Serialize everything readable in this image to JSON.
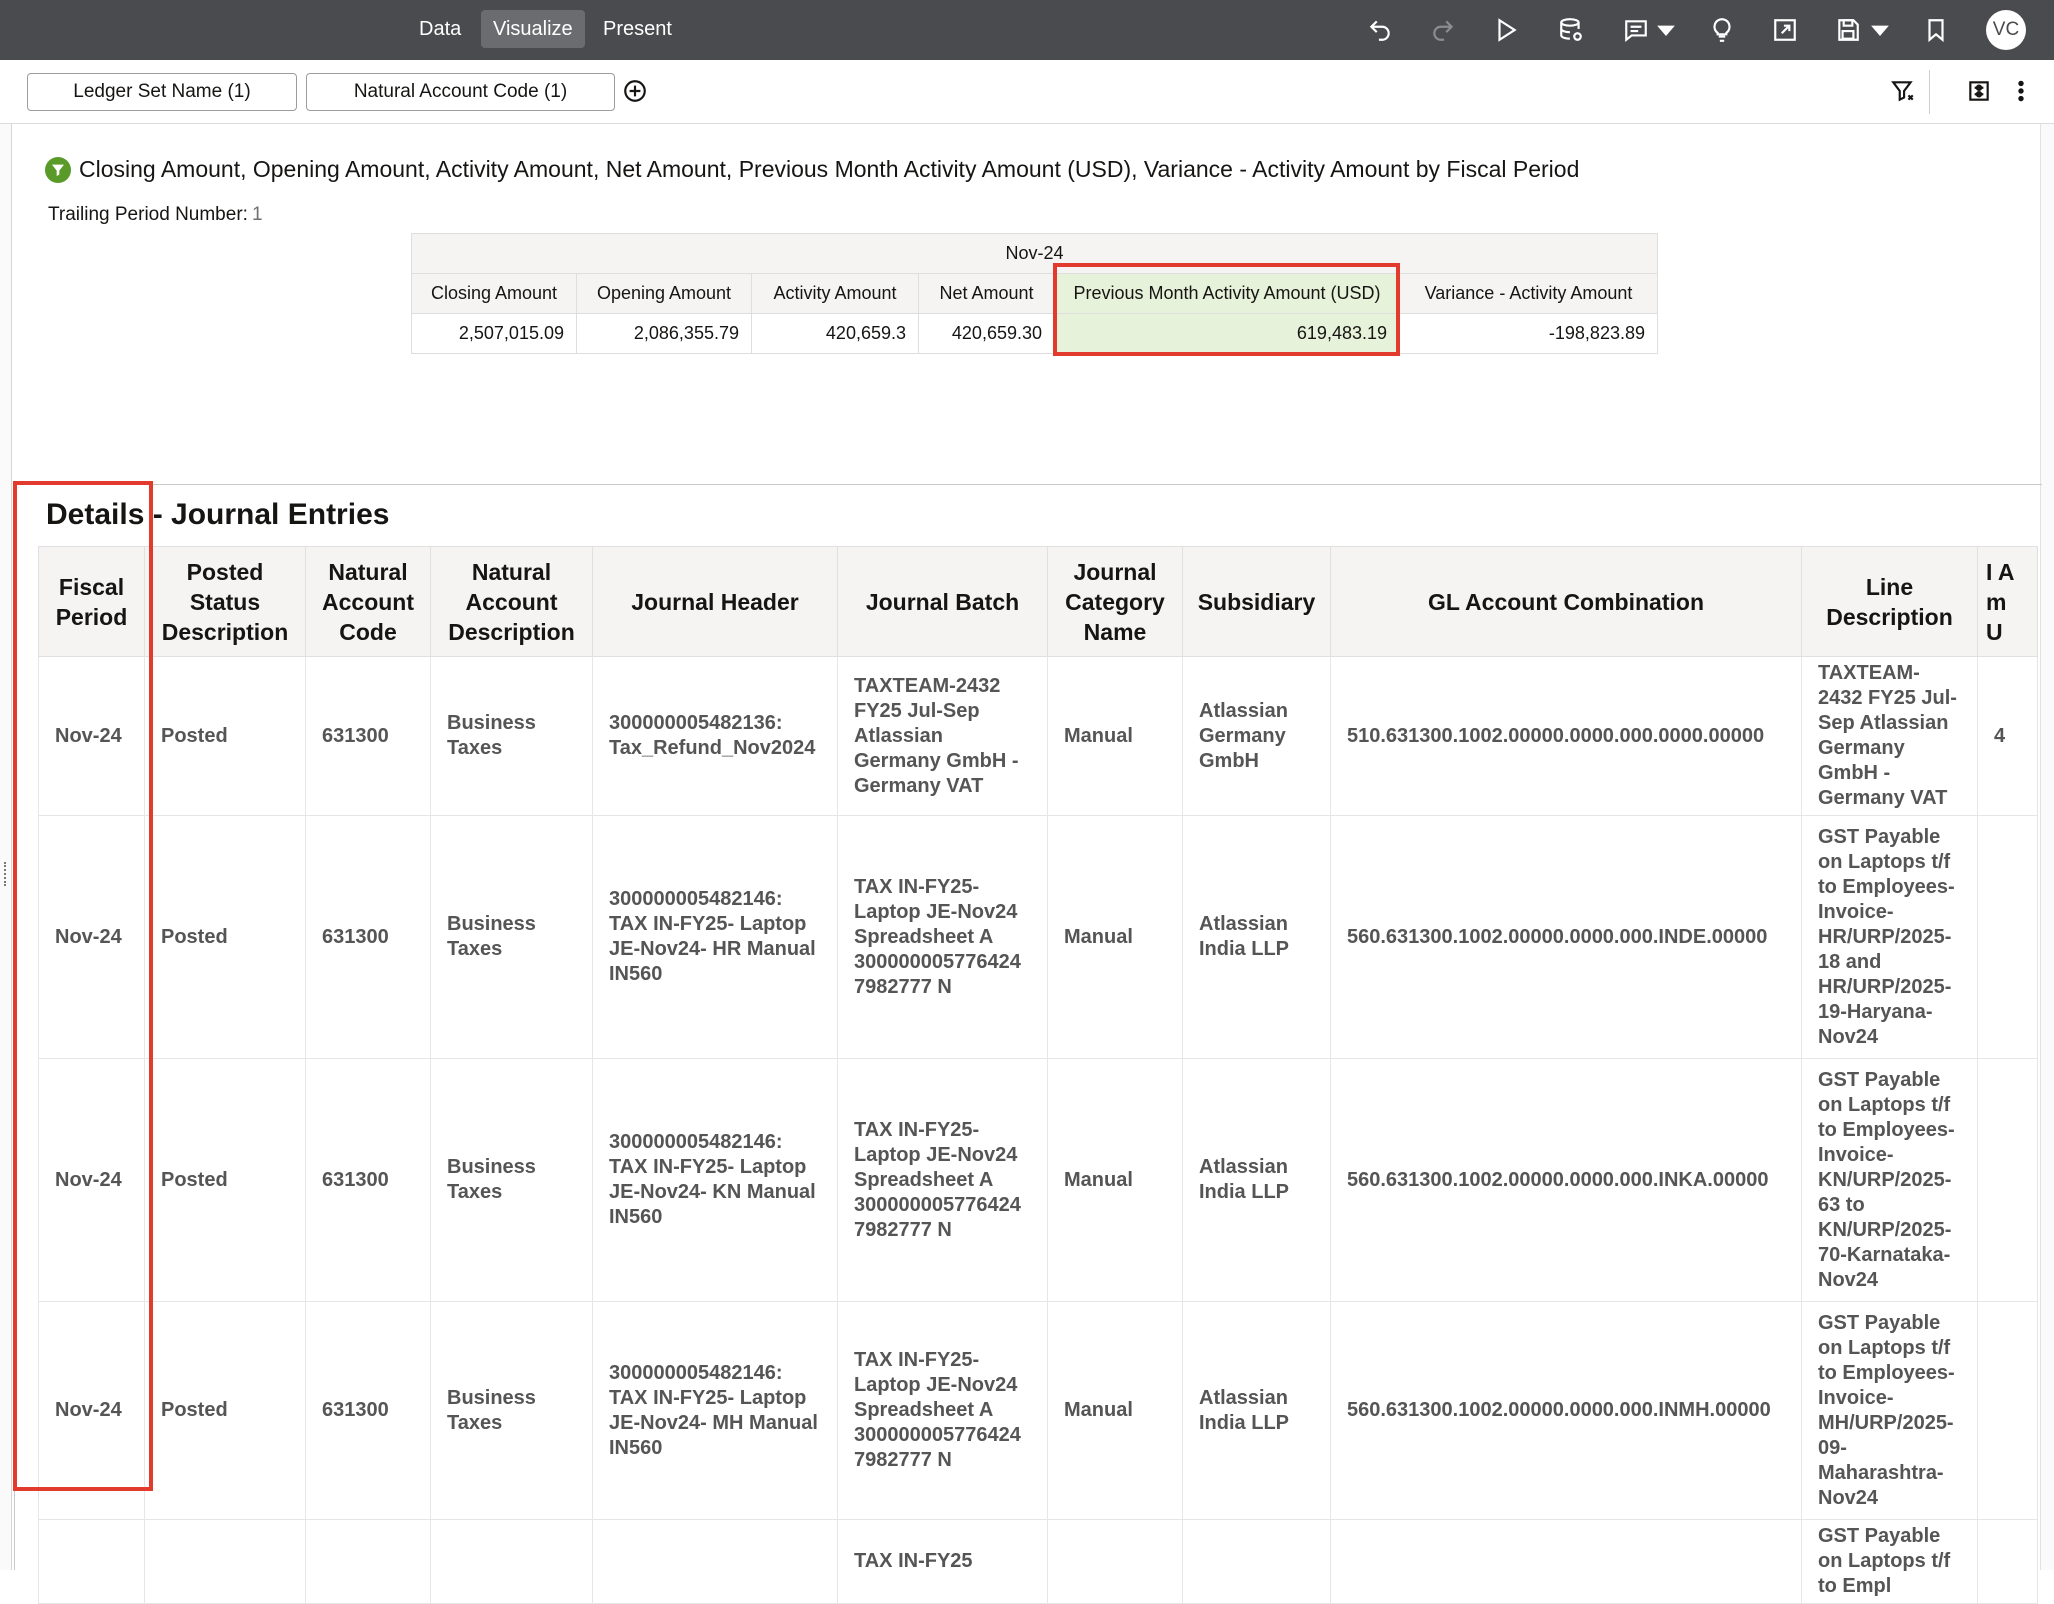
{
  "topbar": {
    "modes": [
      {
        "label": "Data"
      },
      {
        "label": "Visualize"
      },
      {
        "label": "Present"
      }
    ],
    "avatar": "VC"
  },
  "filters": [
    {
      "label": "Ledger Set Name (1)"
    },
    {
      "label": "Natural Account Code (1)"
    }
  ],
  "summary": {
    "title": "Closing Amount, Opening Amount, Activity Amount, Net Amount, Previous Month Activity Amount (USD), Variance - Activity Amount by Fiscal Period",
    "trailing_label": "Trailing Period Number:",
    "trailing_value": "1",
    "period": "Nov-24",
    "columns": [
      "Closing Amount",
      "Opening Amount",
      "Activity Amount",
      "Net Amount",
      "Previous Month Activity Amount (USD)",
      "Variance - Activity Amount"
    ],
    "values": [
      "2,507,015.09",
      "2,086,355.79",
      "420,659.3",
      "420,659.30",
      "619,483.19",
      "-198,823.89"
    ]
  },
  "details": {
    "title": "Details - Journal Entries",
    "columns": [
      "Fiscal Period",
      "Posted Status Description",
      "Natural Account Code",
      "Natural Account Description",
      "Journal Header",
      "Journal Batch",
      "Journal Category Name",
      "Subsidiary",
      "GL Account Combination",
      "Line Description",
      "I Am U"
    ],
    "rows": [
      {
        "fiscal_period": "Nov-24",
        "posted_status": "Posted",
        "account_code": "631300",
        "account_desc": "Business Taxes",
        "journal_header": "300000005482136: Tax_Refund_Nov2024",
        "journal_batch": "TAXTEAM-2432 FY25 Jul-Sep Atlassian Germany GmbH - Germany VAT",
        "category": "Manual",
        "subsidiary": "Atlassian Germany GmbH",
        "gl_combination": "510.631300.1002.00000.0000.000.0000.00000",
        "line_desc": "TAXTEAM-2432 FY25 Jul-Sep Atlassian Germany GmbH - Germany VAT",
        "amount": "4"
      },
      {
        "fiscal_period": "Nov-24",
        "posted_status": "Posted",
        "account_code": "631300",
        "account_desc": "Business Taxes",
        "journal_header": "300000005482146: TAX IN-FY25- Laptop JE-Nov24- HR Manual IN560",
        "journal_batch": "TAX IN-FY25- Laptop JE-Nov24 Spreadsheet A 300000005776424 7982777 N",
        "category": "Manual",
        "subsidiary": "Atlassian India LLP",
        "gl_combination": "560.631300.1002.00000.0000.000.INDE.00000",
        "line_desc": "GST Payable on Laptops t/f to Employees-Invoice-HR/URP/2025-18 and HR/URP/2025-19-Haryana-Nov24",
        "amount": ""
      },
      {
        "fiscal_period": "Nov-24",
        "posted_status": "Posted",
        "account_code": "631300",
        "account_desc": "Business Taxes",
        "journal_header": "300000005482146: TAX IN-FY25- Laptop JE-Nov24- KN Manual IN560",
        "journal_batch": "TAX IN-FY25- Laptop JE-Nov24 Spreadsheet A 300000005776424 7982777 N",
        "category": "Manual",
        "subsidiary": "Atlassian India LLP",
        "gl_combination": "560.631300.1002.00000.0000.000.INKA.00000",
        "line_desc": "GST Payable on Laptops t/f to Employees-Invoice-KN/URP/2025-63 to KN/URP/2025-70-Karnataka-Nov24",
        "amount": ""
      },
      {
        "fiscal_period": "Nov-24",
        "posted_status": "Posted",
        "account_code": "631300",
        "account_desc": "Business Taxes",
        "journal_header": "300000005482146: TAX IN-FY25- Laptop JE-Nov24- MH Manual IN560",
        "journal_batch": "TAX IN-FY25- Laptop JE-Nov24 Spreadsheet A 300000005776424 7982777 N",
        "category": "Manual",
        "subsidiary": "Atlassian India LLP",
        "gl_combination": "560.631300.1002.00000.0000.000.INMH.00000",
        "line_desc": "GST Payable on Laptops t/f to Employees-Invoice-MH/URP/2025-09-Maharashtra-Nov24",
        "amount": ""
      },
      {
        "fiscal_period": "",
        "posted_status": "",
        "account_code": "",
        "account_desc": "",
        "journal_header": "",
        "journal_batch": "TAX IN-FY25",
        "category": "",
        "subsidiary": "",
        "gl_combination": "",
        "line_desc": "GST Payable on Laptops t/f to Empl",
        "amount": ""
      }
    ]
  },
  "colors": {
    "topbar": "#4a4b4e",
    "highlight_box": "#e23b2e",
    "highlight_cell": "#e6f2d9",
    "filter_icon": "#5a9a28"
  },
  "icons": [
    "undo-icon",
    "redo-icon",
    "play-icon",
    "data-refresh-icon",
    "comment-icon",
    "lightbulb-icon",
    "export-icon",
    "save-icon",
    "bookmark-icon",
    "filter-icon",
    "properties-icon",
    "more-icon",
    "add-filter-icon"
  ]
}
